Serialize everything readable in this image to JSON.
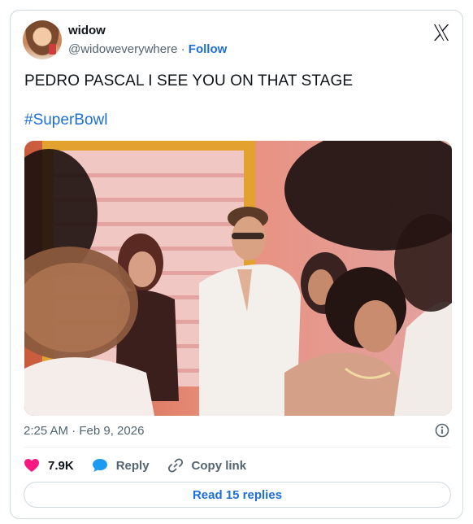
{
  "author": {
    "name": "widow",
    "handle": "@widoweverywhere",
    "separator": " · ",
    "follow_label": "Follow"
  },
  "tweet": {
    "text": "PEDRO PASCAL I SEE YOU ON THAT STAGE",
    "hashtag": "#SuperBowl",
    "timestamp": "2:25 AM · Feb 9, 2026"
  },
  "actions": {
    "likes": "7.9K",
    "reply_label": "Reply",
    "copy_link_label": "Copy link"
  },
  "read_replies_label": "Read 15 replies",
  "icons": {
    "logo": "x-logo-icon",
    "like": "heart-icon",
    "reply": "speech-bubble-icon",
    "copy": "link-icon",
    "info": "info-icon"
  },
  "colors": {
    "link": "#1d6fd6",
    "heart": "#f91880",
    "reply": "#1d9bf0",
    "muted": "#536471"
  }
}
